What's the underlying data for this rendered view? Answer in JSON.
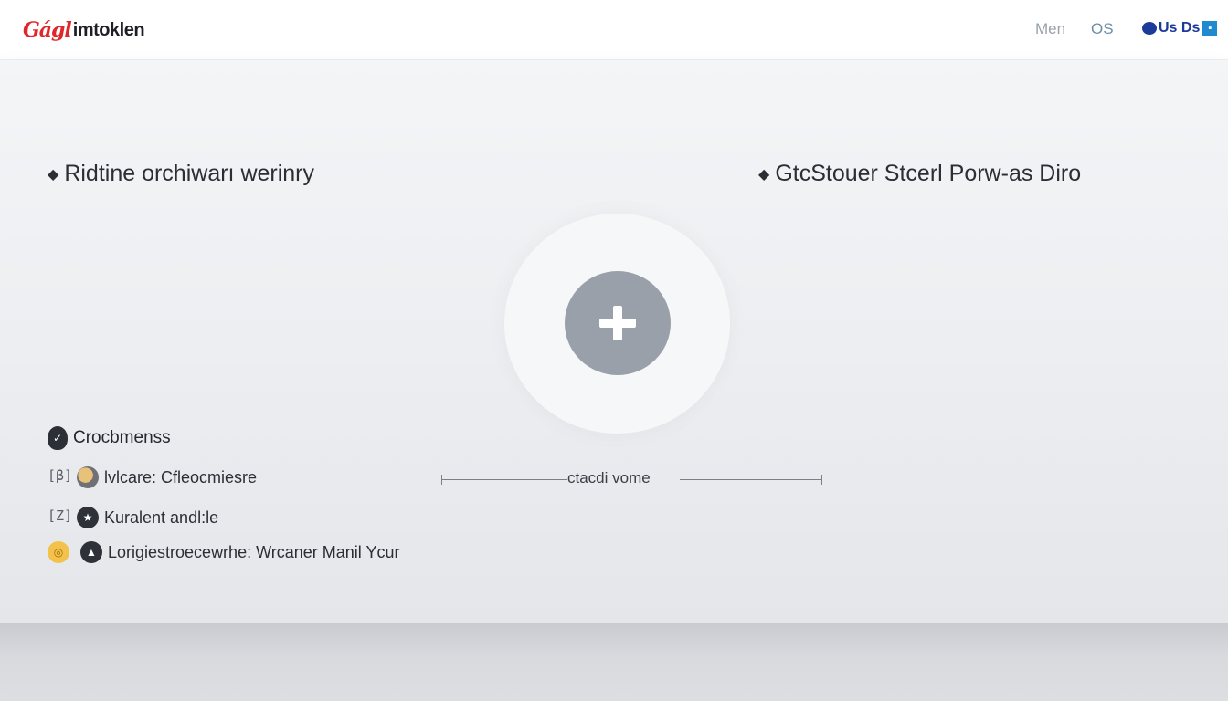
{
  "header": {
    "logo_mark": "Gágl",
    "logo_word": "imtoklen",
    "nav": {
      "item1": "Men",
      "item2": "OS",
      "brand": "Us Ds"
    }
  },
  "main": {
    "heading_left": "Ridtine orchiwarı werinry",
    "heading_right": "GtcStouer Stcerl Porw-as Diro",
    "list_title": "Crocbmenss",
    "rows": [
      {
        "text": "lvlcare: Cfleocmiesre"
      },
      {
        "text": "Kuralent andl:le"
      },
      {
        "text": "Lorigiestroecewrhe: Wrcaner Manil Ycur"
      }
    ],
    "divider_label": "ctacdi vome"
  },
  "colors": {
    "brand_red": "#e0262b",
    "plus_button": "#9aa0a9",
    "nav_brand_blue": "#1d3a9b"
  }
}
